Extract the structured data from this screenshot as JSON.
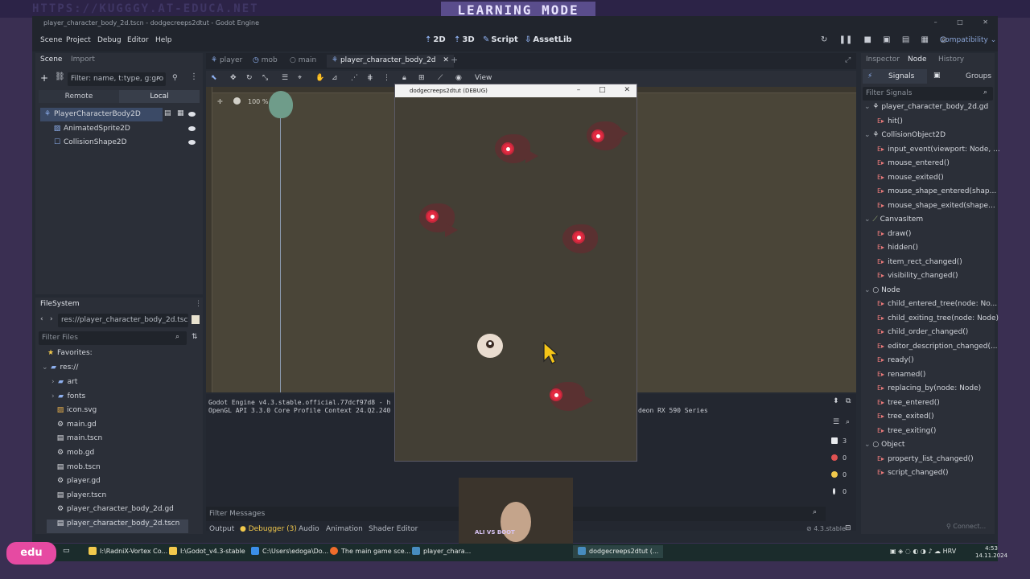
{
  "banner": {
    "url": "HTTPS://KUGGGY.AT-EDUCA.NET",
    "mode": "LEARNING MODE"
  },
  "window": {
    "title": "player_character_body_2d.tscn - dodgecreeps2dtut - Godot Engine",
    "controls": [
      "–",
      "□",
      "✕"
    ]
  },
  "menu": [
    "Scene",
    "Project",
    "Debug",
    "Editor",
    "Help"
  ],
  "modes": {
    "m2d": "2D",
    "m3d": "3D",
    "script": "Script",
    "assetlib": "AssetLib"
  },
  "renderer": "Compatibility",
  "scene_dock": {
    "tabs": [
      "Scene",
      "Import"
    ],
    "filter_placeholder": "Filter: name, t:type, g:gro",
    "remote": "Remote",
    "local": "Local",
    "tree": [
      {
        "label": "PlayerCharacterBody2D",
        "icon": "character-body-icon"
      },
      {
        "label": "AnimatedSprite2D",
        "icon": "sprite-icon"
      },
      {
        "label": "CollisionShape2D",
        "icon": "collision-shape-icon"
      }
    ]
  },
  "filesystem": {
    "title": "FileSystem",
    "path": "res://player_character_body_2d.tscn",
    "filter_placeholder": "Filter Files",
    "favorites": "Favorites:",
    "root": "res://",
    "items": [
      {
        "label": "art",
        "kind": "folder"
      },
      {
        "label": "fonts",
        "kind": "folder"
      },
      {
        "label": "icon.svg",
        "kind": "file"
      },
      {
        "label": "main.gd",
        "kind": "script"
      },
      {
        "label": "main.tscn",
        "kind": "scene"
      },
      {
        "label": "mob.gd",
        "kind": "script"
      },
      {
        "label": "mob.tscn",
        "kind": "scene"
      },
      {
        "label": "player.gd",
        "kind": "script"
      },
      {
        "label": "player.tscn",
        "kind": "scene"
      },
      {
        "label": "player_character_body_2d.gd",
        "kind": "script"
      },
      {
        "label": "player_character_body_2d.tscn",
        "kind": "scene"
      }
    ]
  },
  "scene_tabs": [
    "player",
    "mob",
    "main",
    "player_character_body_2d"
  ],
  "viewport": {
    "view_menu": "View",
    "zoom": "100 %"
  },
  "output": {
    "line1": "Godot Engine v4.3.stable.official.77dcf97d8 - h",
    "line2": "OpenGL API 3.3.0 Core Profile Context 24.Q2.240",
    "line2b": "deon RX 590 Series",
    "filter_placeholder": "Filter Messages",
    "version": "4.3.stable",
    "counters": [
      "3",
      "0",
      "0",
      "0"
    ]
  },
  "bottom_tabs": [
    "Output",
    "Debugger (3)",
    "Audio",
    "Animation",
    "Shader Editor"
  ],
  "game_window": {
    "title": "dodgecreeps2dtut (DEBUG)"
  },
  "inspector": {
    "tabs": [
      "Inspector",
      "Node",
      "History"
    ],
    "sub_tabs": [
      "Signals",
      "Groups"
    ],
    "filter_placeholder": "Filter Signals",
    "groups": [
      {
        "name": "player_character_body_2d.gd",
        "signals": [
          "hit()"
        ]
      },
      {
        "name": "CollisionObject2D",
        "signals": [
          "input_event(viewport: Node, ...",
          "mouse_entered()",
          "mouse_exited()",
          "mouse_shape_entered(shap...",
          "mouse_shape_exited(shape..."
        ]
      },
      {
        "name": "CanvasItem",
        "signals": [
          "draw()",
          "hidden()",
          "item_rect_changed()",
          "visibility_changed()"
        ]
      },
      {
        "name": "Node",
        "signals": [
          "child_entered_tree(node: No...",
          "child_exiting_tree(node: Node)",
          "child_order_changed()",
          "editor_description_changed(...",
          "ready()",
          "renamed()",
          "replacing_by(node: Node)",
          "tree_entered()",
          "tree_exited()",
          "tree_exiting()"
        ]
      },
      {
        "name": "Object",
        "signals": [
          "property_list_changed()",
          "script_changed()"
        ]
      }
    ],
    "connect": "Connect..."
  },
  "webcam_label": "ALI VS BOOT",
  "taskbar": {
    "items": [
      "I:\\RadniX-Vortex Co...",
      "I:\\Godot_v4.3-stable",
      "C:\\Users\\edoga\\Do...",
      "The main game sce...",
      "player_chara...",
      "dodgecreeps2dtut (..."
    ],
    "lang": "HRV",
    "time": "4:53",
    "date": "14.11.2024"
  },
  "logo": "edu",
  "colors": {
    "editor_bg": "#252a33",
    "panel_bg": "#2b2f38",
    "accent": "#8eb0ef",
    "game_bg": "#433f35",
    "mob_body": "#5a3131",
    "mob_eye": "#e32b41",
    "signal_arrow": "#ea7a7a"
  }
}
